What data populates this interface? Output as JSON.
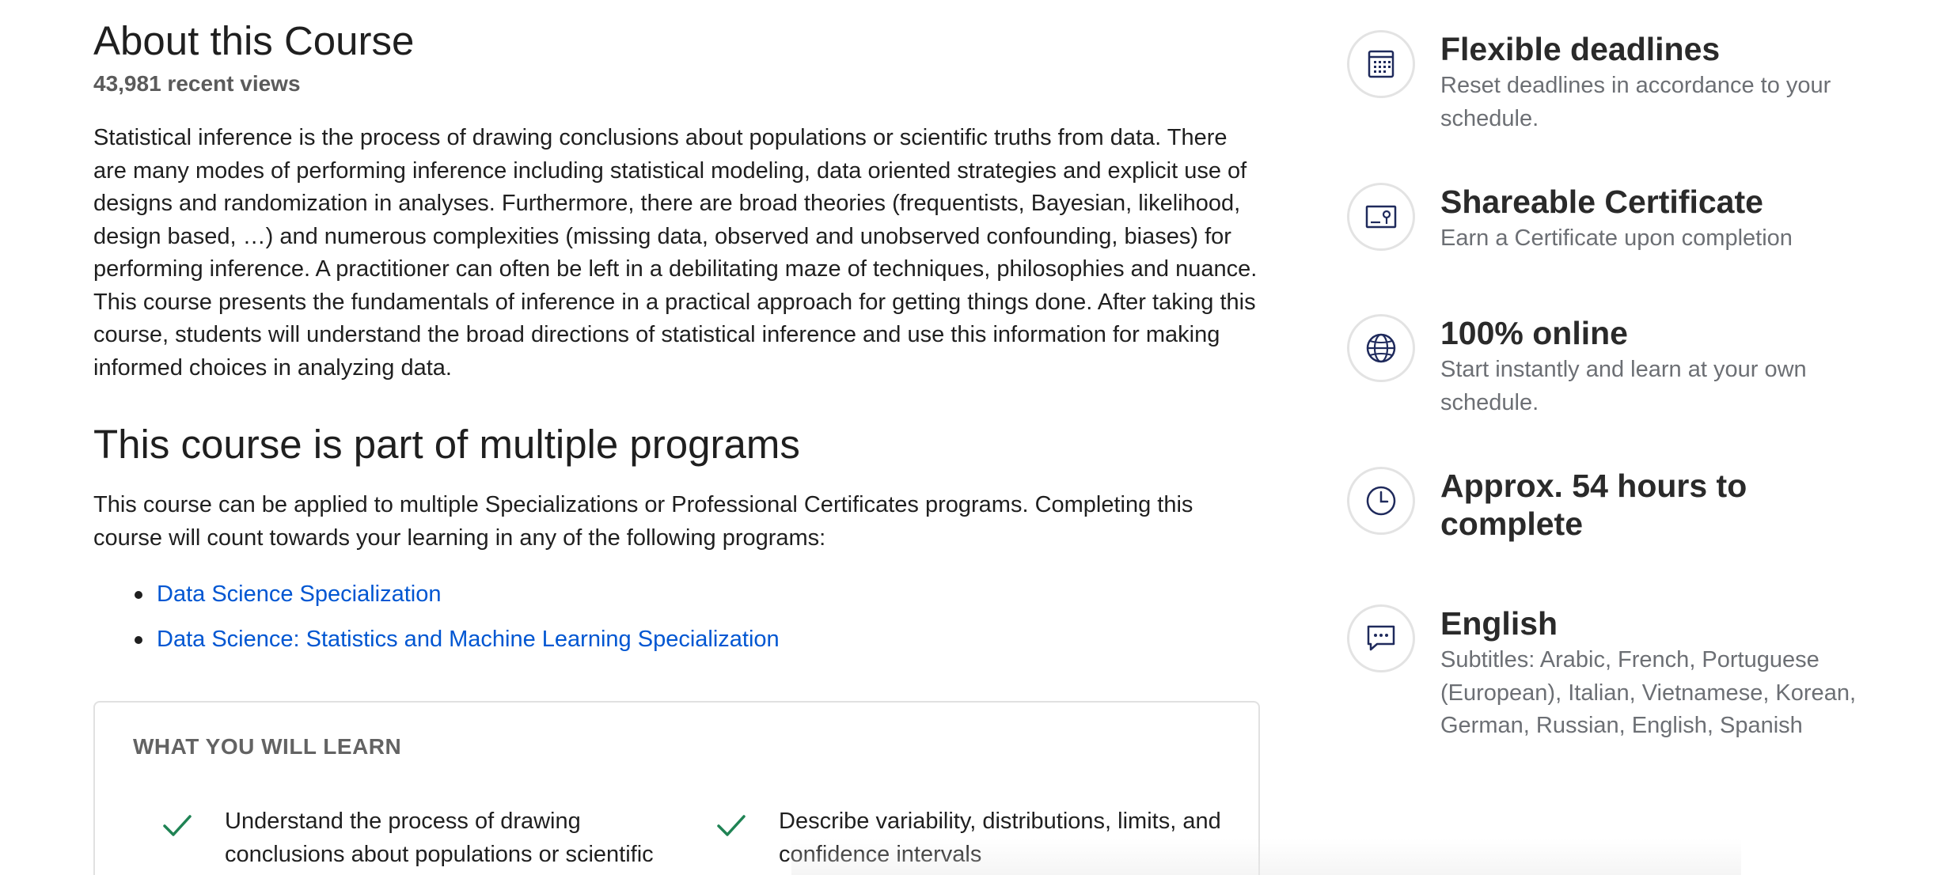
{
  "about": {
    "title": "About this Course",
    "views": "43,981 recent views",
    "description": "Statistical inference is the process of drawing conclusions about populations or scientific truths from data. There are many modes of performing inference including statistical modeling, data oriented strategies and explicit use of designs and randomization in analyses. Furthermore, there are broad theories (frequentists, Bayesian, likelihood, design based, …) and numerous complexities (missing data, observed and unobserved confounding, biases) for performing inference. A practitioner can often be left in a debilitating maze of techniques, philosophies and nuance. This course presents the fundamentals of inference in a practical approach for getting things done. After taking this course, students will understand the broad directions of statistical inference and use this information for making informed choices in analyzing data."
  },
  "programs": {
    "title": "This course is part of multiple programs",
    "description": "This course can be applied to multiple Specializations or Professional Certificates programs. Completing this course will count towards your learning in any of the following programs:",
    "links": [
      {
        "label": "Data Science Specialization"
      },
      {
        "label": "Data Science: Statistics and Machine Learning Specialization"
      }
    ]
  },
  "learn": {
    "title": "WHAT YOU WILL LEARN",
    "items": [
      {
        "text": "Understand the process of drawing conclusions about populations or scientific"
      },
      {
        "text": "Describe variability, distributions, limits, and confidence intervals"
      }
    ]
  },
  "features": [
    {
      "icon": "calendar-icon",
      "title": "Flexible deadlines",
      "subtitle": "Reset deadlines in accordance to your schedule."
    },
    {
      "icon": "certificate-icon",
      "title": "Shareable Certificate",
      "subtitle": "Earn a Certificate upon completion"
    },
    {
      "icon": "globe-icon",
      "title": "100% online",
      "subtitle": "Start instantly and learn at your own schedule."
    },
    {
      "icon": "clock-icon",
      "title": "Approx. 54 hours to complete",
      "subtitle": ""
    },
    {
      "icon": "chat-bubble-icon",
      "title": "English",
      "subtitle": "Subtitles: Arabic, French, Portuguese (European), Italian, Vietnamese, Korean, German, Russian, English, Spanish"
    }
  ],
  "colors": {
    "link": "#0056d2",
    "check": "#1f8354",
    "icon": "#1f2a5c"
  }
}
